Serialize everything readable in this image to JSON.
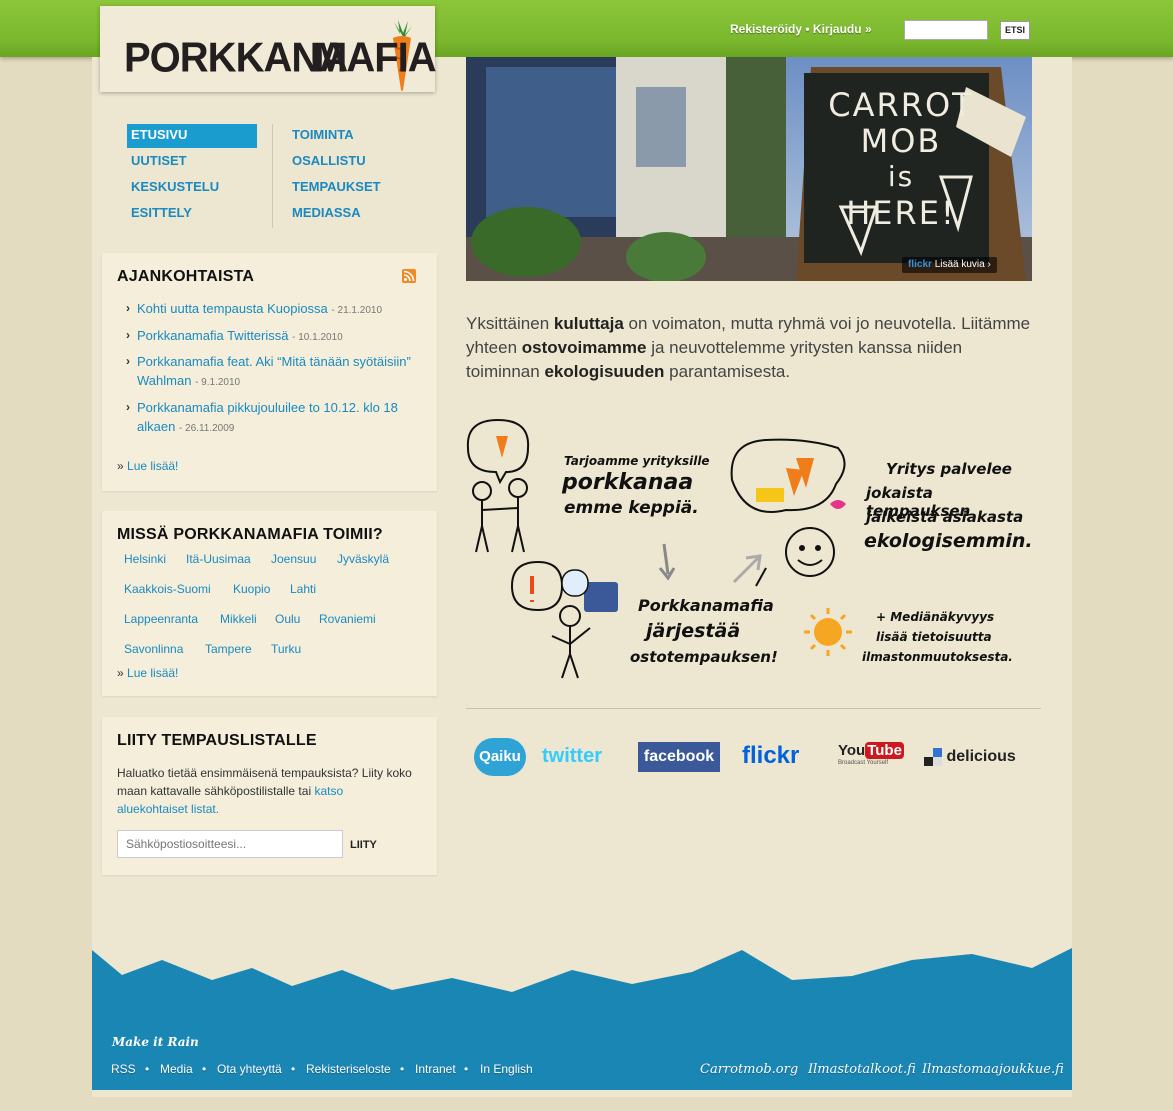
{
  "header": {
    "logo_left": "PORKKANA",
    "logo_right": "MAFIA",
    "register": "Rekisteröidy",
    "login": "Kirjaudu",
    "search_button": "ETSI"
  },
  "nav": {
    "left": [
      "ETUSIVU",
      "UUTISET",
      "KESKUSTELU",
      "ESITTELY"
    ],
    "right": [
      "TOIMINTA",
      "OSALLISTU",
      "TEMPAUKSET",
      "MEDIASSA"
    ],
    "active": "ETUSIVU"
  },
  "news": {
    "title": "AJANKOHTAISTA",
    "items": [
      {
        "text": "Kohti uutta tempausta Kuopiossa",
        "date": "- 21.1.2010"
      },
      {
        "text": "Porkkanamafia Twitterissä",
        "date": "- 10.1.2010"
      },
      {
        "text": "Porkkanamafia feat. Aki “Mitä tänään syötäisiin” Wahlman",
        "date": "- 9.1.2010"
      },
      {
        "text": "Porkkanamafia pikkujouluilee to 10.12. klo 18 alkaen",
        "date": "- 26.11.2009"
      }
    ],
    "more": "Lue lisää!"
  },
  "locations": {
    "title": "MISSÄ PORKKANAMAFIA TOIMII?",
    "cities": [
      "Helsinki",
      "Itä-Uusimaa",
      "Joensuu",
      "Jyväskylä",
      "Kaakkois-Suomi",
      "Kuopio",
      "Lahti",
      "Lappeenranta",
      "Mikkeli",
      "Oulu",
      "Rovaniemi",
      "Savonlinna",
      "Tampere",
      "Turku"
    ],
    "more": "Lue lisää!"
  },
  "newsletter": {
    "title": "LIITY TEMPAUSLISTALLE",
    "text": "Haluatko tietää ensimmäisenä tempauksista? Liity koko maan kattavalle sähköpostilistalle tai",
    "link": "katso aluekohtaiset listat.",
    "placeholder": "Sähköpostiosoitteesi...",
    "button": "LIITY"
  },
  "hero": {
    "sign_line1": "CARROT",
    "sign_line2": "MOB",
    "sign_line3": "is",
    "sign_line4": "HERE!",
    "flickr": "flickr",
    "more_photos": "Lisää kuvia ›"
  },
  "intro": {
    "p1": "Yksittäinen",
    "b1": "kuluttaja",
    "p2": "on voimaton, mutta ryhmä voi jo neuvotella. Liitämme yhteen",
    "b2": "ostovoimamme",
    "p3": "ja neuvottelemme yritysten kanssa niiden toiminnan",
    "b3": "ekologisuuden",
    "p4": "parantamisesta."
  },
  "infographic": {
    "t1a": "Tarjoamme yrityksille",
    "t1b": "porkkanaa",
    "t1c": "emme keppiä.",
    "t2a": "Yritys palvelee",
    "t2b": "jokaista tempauksen",
    "t2c": "jälkeistä asiakasta",
    "t2d": "ekologisemmin.",
    "t3a": "Porkkanamafia",
    "t3b": "järjestää",
    "t3c": "ostotempauksen!",
    "t4a": "+ Mediänäkyvyys",
    "t4b": "lisää tietoisuutta",
    "t4c": "ilmastonmuutoksesta."
  },
  "social": {
    "qaiku": "Qaiku",
    "twitter": "twitter",
    "facebook": "facebook",
    "flickr": "flickr",
    "youtube_you": "You",
    "youtube_tube": "Tube",
    "youtube_tagline": "Broadcast Yourself",
    "delicious": "delicious"
  },
  "footer": {
    "tagline": "Make it Rain",
    "links": [
      "RSS",
      "Media",
      "Ota yhteyttä",
      "Rekisteriseloste",
      "Intranet",
      "In English"
    ],
    "partners": [
      "Carrotmob.org",
      "Ilmastotalkoot.fi",
      "Ilmastomaajoukkue.fi"
    ]
  },
  "colors": {
    "top_green": "#7bb82e",
    "link_blue": "#1a8ac0",
    "active_nav": "#1a9ccf",
    "footer_blue": "#1a86b4",
    "carrot": "#f07d1a"
  }
}
